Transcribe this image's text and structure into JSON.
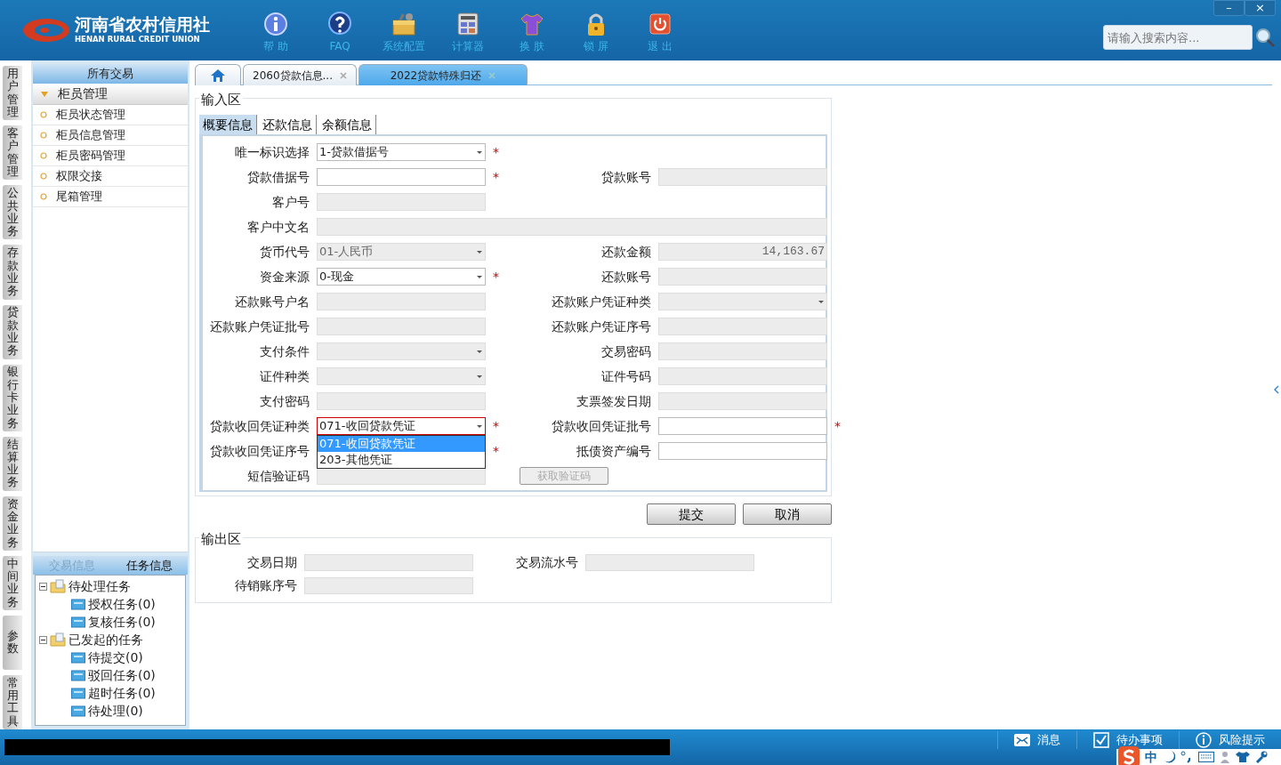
{
  "header": {
    "logo_name": "河南省农村信用社",
    "logo_subtitle": "HENAN RURAL CREDIT UNION",
    "tools": [
      {
        "kind": "info",
        "label": "帮 助"
      },
      {
        "kind": "question",
        "label": "FAQ"
      },
      {
        "kind": "toolbox",
        "label": "系统配置"
      },
      {
        "kind": "calculator",
        "label": "计算器"
      },
      {
        "kind": "shirt",
        "label": "换 肤"
      },
      {
        "kind": "lock",
        "label": "锁 屏"
      },
      {
        "kind": "power",
        "label": "退 出"
      }
    ],
    "search": {
      "placeholder": "请输入搜索内容..."
    },
    "window_buttons": [
      {
        "label": "–"
      },
      {
        "label": "×"
      }
    ]
  },
  "side_nav": [
    {
      "label": "用户管理"
    },
    {
      "label": "客户管理"
    },
    {
      "label": "公共业务"
    },
    {
      "label": "存款业务"
    },
    {
      "label": "贷款业务"
    },
    {
      "label": "银行卡业务"
    },
    {
      "label": "结算业务"
    },
    {
      "label": "资金业务"
    },
    {
      "label": "中间业务"
    },
    {
      "label": "参数"
    },
    {
      "label": "常用工具"
    }
  ],
  "sidebar": {
    "title": "所有交易",
    "group": {
      "label": "柜员管理",
      "expanded": true,
      "items": [
        "柜员状态管理",
        "柜员信息管理",
        "柜员密码管理",
        "权限交接",
        "尾箱管理"
      ]
    },
    "bottom_tabs": [
      {
        "label": "交易信息",
        "selected": false
      },
      {
        "label": "任务信息",
        "selected": true
      }
    ],
    "tree": [
      {
        "label": "待处理任务",
        "expanded": true,
        "children": [
          {
            "label": "授权任务(0)"
          },
          {
            "label": "复核任务(0)"
          }
        ]
      },
      {
        "label": "已发起的任务",
        "expanded": true,
        "children": [
          {
            "label": "待提交(0)"
          },
          {
            "label": "驳回任务(0)"
          },
          {
            "label": "超时任务(0)"
          },
          {
            "label": "待处理(0)"
          }
        ]
      }
    ]
  },
  "tabs": [
    {
      "kind": "home",
      "selected": false
    },
    {
      "kind": "page",
      "label": "2060贷款信息...",
      "selected": false
    },
    {
      "kind": "page",
      "label": "2022贷款特殊归还",
      "selected": true
    }
  ],
  "input_area": {
    "title": "输入区",
    "tabs": [
      {
        "label": "概要信息",
        "selected": true
      },
      {
        "label": "还款信息",
        "selected": false
      },
      {
        "label": "余额信息",
        "selected": false
      }
    ],
    "rows": [
      [
        {
          "label": "唯一标识选择",
          "kind": "select",
          "value": "1-贷款借据号",
          "disabled": false,
          "required_mark": "*"
        }
      ],
      [
        {
          "label": "贷款借据号",
          "kind": "text",
          "disabled": false,
          "required_mark": "*"
        },
        {
          "label": "贷款账号",
          "kind": "text",
          "disabled": true
        }
      ],
      [
        {
          "label": "客户号",
          "kind": "text",
          "disabled": true
        }
      ],
      [
        {
          "label": "客户中文名",
          "kind": "wide",
          "disabled": true
        }
      ],
      [
        {
          "label": "货币代号",
          "kind": "select",
          "value": "01-人民币",
          "disabled": true
        },
        {
          "label": "还款金额",
          "kind": "amount",
          "value": "14,163.67",
          "disabled": true
        }
      ],
      [
        {
          "label": "资金来源",
          "kind": "select",
          "value": "0-现金",
          "disabled": false,
          "required_mark": "*"
        },
        {
          "label": "还款账号",
          "kind": "text",
          "disabled": true
        }
      ],
      [
        {
          "label": "还款账号户名",
          "kind": "text",
          "disabled": true
        },
        {
          "label": "还款账户凭证种类",
          "kind": "select",
          "disabled": true
        }
      ],
      [
        {
          "label": "还款账户凭证批号",
          "kind": "text",
          "disabled": true
        },
        {
          "label": "还款账户凭证序号",
          "kind": "text",
          "disabled": true
        }
      ],
      [
        {
          "label": "支付条件",
          "kind": "select",
          "disabled": true
        },
        {
          "label": "交易密码",
          "kind": "text",
          "disabled": true
        }
      ],
      [
        {
          "label": "证件种类",
          "kind": "select",
          "disabled": true
        },
        {
          "label": "证件号码",
          "kind": "text",
          "disabled": true
        }
      ],
      [
        {
          "label": "支付密码",
          "kind": "text",
          "disabled": true
        },
        {
          "label": "支票签发日期",
          "kind": "text",
          "disabled": true
        }
      ],
      [
        {
          "label": "贷款收回凭证种类",
          "kind": "select",
          "value": "071-收回贷款凭证",
          "disabled": false,
          "required_mark": "*",
          "expanded": true,
          "options": [
            {
              "label": "071-收回贷款凭证",
              "selected": true
            },
            {
              "label": "203-其他凭证",
              "selected": false
            }
          ]
        },
        {
          "label": "贷款收回凭证批号",
          "kind": "text",
          "disabled": false,
          "required_mark": "*"
        }
      ],
      [
        {
          "label": "贷款收回凭证序号",
          "kind": "covered",
          "required_mark": "*"
        },
        {
          "label": "抵债资产编号",
          "kind": "text",
          "disabled": false
        }
      ],
      [
        {
          "label": "短信验证码",
          "kind": "text",
          "disabled": true
        },
        {
          "label": "获取验证码",
          "kind": "button",
          "disabled": true
        }
      ]
    ]
  },
  "actions": [
    {
      "label": "提交"
    },
    {
      "label": "取消"
    }
  ],
  "output_area": {
    "title": "输出区",
    "rows": [
      [
        {
          "label": "交易日期"
        },
        {
          "label": "交易流水号"
        }
      ],
      [
        {
          "label": "待销账序号"
        }
      ]
    ]
  },
  "status_bar": {
    "items": [
      {
        "kind": "message",
        "label": "消息"
      },
      {
        "kind": "todo",
        "label": "待办事项"
      },
      {
        "kind": "risk",
        "label": "风险提示"
      }
    ],
    "ime": {
      "label": "中"
    }
  }
}
